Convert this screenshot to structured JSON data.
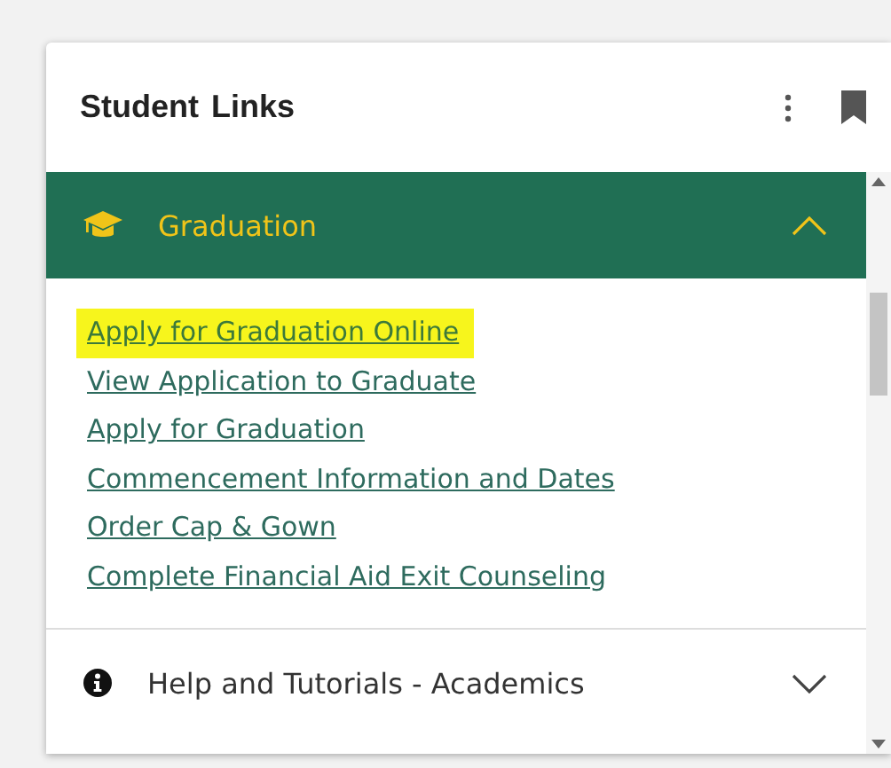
{
  "card": {
    "title": "Student Links"
  },
  "sections": [
    {
      "title": "Graduation",
      "kind": "graduation",
      "expanded": true,
      "links": [
        {
          "text": "Apply for Graduation Online",
          "highlighted": true
        },
        {
          "text": "View Application to Graduate",
          "highlighted": false
        },
        {
          "text": "Apply for Graduation",
          "highlighted": false
        },
        {
          "text": "Commencement Information and Dates",
          "highlighted": false
        },
        {
          "text": "Order Cap & Gown",
          "highlighted": false
        },
        {
          "text": "Complete Financial Aid Exit Counseling",
          "highlighted": false
        }
      ]
    },
    {
      "title": "Help and Tutorials - Academics",
      "kind": "info",
      "expanded": false
    }
  ]
}
